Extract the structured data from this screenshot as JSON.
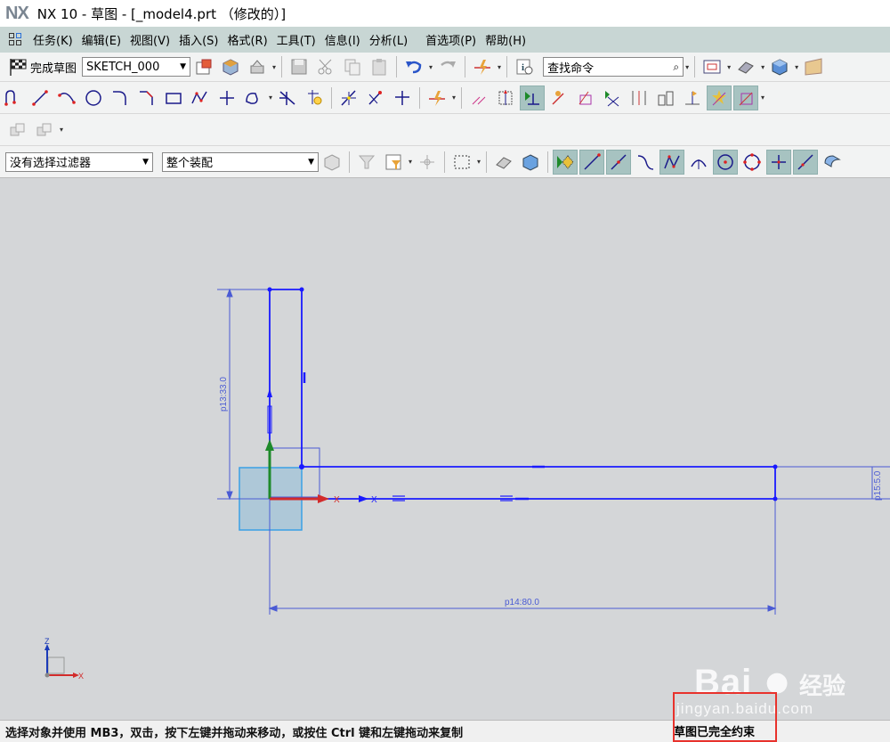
{
  "window": {
    "logo": "NX",
    "title": "NX 10 - 草图 - [_model4.prt （修改的）]"
  },
  "menu": [
    "任务(K)",
    "编辑(E)",
    "视图(V)",
    "插入(S)",
    "格式(R)",
    "工具(T)",
    "信息(I)",
    "分析(L)",
    "首选项(P)",
    "帮助(H)"
  ],
  "toolbar": {
    "finish_sketch": "完成草图",
    "sketch_name": "SKETCH_000",
    "search_placeholder": "查找命令",
    "filter": "没有选择过滤器",
    "assembly_scope": "整个装配"
  },
  "icons": {
    "row1": [
      "finish-flag-icon",
      "save-icon",
      "cut-icon",
      "copy-icon",
      "paste-icon",
      "undo-icon",
      "redo-icon",
      "sketch-task-icon",
      "info-icon",
      "search-icon",
      "fit-view-icon",
      "shade-icon",
      "cube-icon"
    ],
    "row2": [
      "profile-icon",
      "line-icon",
      "arc-icon",
      "circle-icon",
      "fillet-icon",
      "chamfer-icon",
      "rectangle-icon",
      "polygon-icon",
      "point-icon",
      "offset-curve-icon",
      "quick-trim-icon",
      "quick-extend-icon",
      "make-corner-icon",
      "derived-line-icon",
      "dimension-icon",
      "constraint-icon",
      "show-constraints-icon",
      "auto-constraint-icon"
    ],
    "row4": [
      "type-filter-icon",
      "select-all-icon",
      "snap-endpoint-icon",
      "snap-midpoint-icon",
      "snap-control-icon",
      "snap-intersection-icon",
      "snap-arc-center-icon",
      "snap-quadrant-icon",
      "snap-existing-point-icon",
      "snap-on-curve-icon"
    ]
  },
  "sketch": {
    "dimensions": {
      "height": "p13:33.0",
      "length": "p14:80.0",
      "thickness": "p15:5.0"
    },
    "axis_labels": {
      "x": "X",
      "y": "Z",
      "x_small": "X"
    },
    "colors": {
      "geometry": "#1a1aff",
      "dimension": "#4a5bd4",
      "x_axis": "#d22b2b",
      "y_axis": "#1e8a2a",
      "datum_fill": "#a7c5d8"
    }
  },
  "status": {
    "prompt": "选择对象并使用 MB3，双击，按下左键并拖动来移动，或按住 Ctrl 键和左键拖动来复制",
    "sketch_state": "草图已完全约束"
  },
  "watermark": {
    "brand": "Bai",
    "brand2": "经验",
    "url": "jingyan.baidu.com"
  }
}
